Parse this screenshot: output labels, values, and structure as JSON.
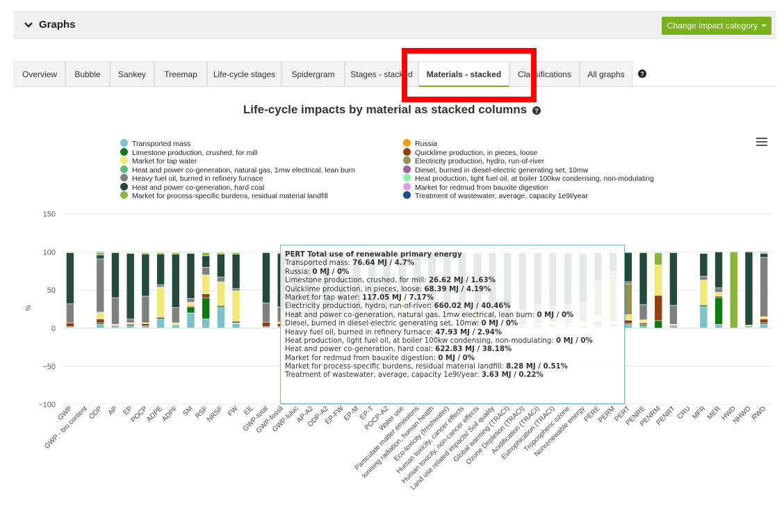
{
  "header": {
    "title": "Graphs",
    "change_button": "Change impact category"
  },
  "tabs": [
    {
      "label": "Overview"
    },
    {
      "label": "Bubble"
    },
    {
      "label": "Sankey"
    },
    {
      "label": "Treemap"
    },
    {
      "label": "Life-cycle stages"
    },
    {
      "label": "Spidergram"
    },
    {
      "label": "Stages - stacked"
    },
    {
      "label": "Materials - stacked",
      "active": true
    },
    {
      "label": "Classifications"
    },
    {
      "label": "All graphs"
    }
  ],
  "chart": {
    "title": "Life-cycle impacts by material as stacked columns"
  },
  "legend": [
    {
      "label": "Transported mass",
      "color": "#7cc2cc"
    },
    {
      "label": "Limestone production, crushed, for mill",
      "color": "#0d7a12"
    },
    {
      "label": "Market for tap water",
      "color": "#f2e777"
    },
    {
      "label": "Heat and power co-generation, natural gas, 1mw electrical, lean burn",
      "color": "#5cbd7a"
    },
    {
      "label": "Heavy fuel oil, burned in refinery furnace",
      "color": "#808080"
    },
    {
      "label": "Heat and power co-generation, hard coal",
      "color": "#25493a"
    },
    {
      "label": "Market for process-specific burdens, residual material landfill",
      "color": "#8db340"
    },
    {
      "label": "Russia",
      "color": "#f19e0e"
    },
    {
      "label": "Quicklime production, in pieces, loose",
      "color": "#923f0d"
    },
    {
      "label": "Electricity production, hydro, run-of-river",
      "color": "#9a9150"
    },
    {
      "label": "Diesel, burned in diesel-electric generating set, 10mw",
      "color": "#a35e9a"
    },
    {
      "label": "Heat production, light fuel oil, at boiler 100kw condensing, non-modulating",
      "color": "#90eeb1"
    },
    {
      "label": "Market for redmud from bauxite digestion",
      "color": "#dda0dd"
    },
    {
      "label": "Treatment of wastewater, average, capacity 1e9l/year",
      "color": "#1f4e8a"
    }
  ],
  "tooltip": {
    "title": "PERT Total use of renewable primary energy",
    "rows": [
      {
        "label": "Transported mass:",
        "value": "76.64 MJ / 4.7%"
      },
      {
        "label": "Russia:",
        "value": "0 MJ / 0%"
      },
      {
        "label": "Limestone production, crushed, for mill:",
        "value": "26.62 MJ / 1.63%"
      },
      {
        "label": "Quicklime production, in pieces, loose:",
        "value": "68.39 MJ / 4.19%"
      },
      {
        "label": "Market for tap water:",
        "value": "117.05 MJ / 7.17%"
      },
      {
        "label": "Electricity production, hydro, run-of-river:",
        "value": "660.02 MJ / 40.46%"
      },
      {
        "label": "Heat and power co-generation, natural gas, 1mw electrical, lean burn:",
        "value": "0 MJ / 0%"
      },
      {
        "label": "Diesel, burned in diesel-electric generating set, 10mw:",
        "value": "0 MJ / 0%"
      },
      {
        "label": "Heavy fuel oil, burned in refinery furnace:",
        "value": "47.93 MJ / 2.94%"
      },
      {
        "label": "Heat production, light fuel oil, at boiler 100kw condensing, non-modulating:",
        "value": "0 MJ / 0%"
      },
      {
        "label": "Heat and power co-generation, hard coal:",
        "value": "622.83 MJ / 38.18%"
      },
      {
        "label": "Market for redmud from bauxite digestion:",
        "value": "0 MJ / 0%"
      },
      {
        "label": "Market for process-specific burdens, residual material landfill:",
        "value": "8.28 MJ / 0.51%"
      },
      {
        "label": "Treatment of wastewater, average, capacity 1e9l/year:",
        "value": "3.63 MJ / 0.22%"
      }
    ]
  },
  "chart_data": {
    "type": "bar",
    "stacked": true,
    "ylabel": "%",
    "ylim": [
      -100,
      150
    ],
    "yticks": [
      150,
      100,
      50,
      0,
      -50,
      -100
    ],
    "grid": true,
    "legend_position": "top",
    "categories": [
      "GWP",
      "GWP - bio content",
      "ODP",
      "AP",
      "EP",
      "POCP",
      "ADPE",
      "ADPF",
      "SM",
      "RSF",
      "NRSF",
      "FW",
      "EE",
      "GWP-total",
      "GWP-fossil",
      "GWP-luluc",
      "AP-A2",
      "ODP-A2",
      "EP-FW",
      "EP-M",
      "EP-T",
      "POCP-A2",
      "Water use",
      "Particulate matter emissions",
      "Ionising radiation, human health",
      "Eco-toxicity (freshwater)",
      "Human toxicity, cancer effects",
      "Human toxicity, non-cancer effects",
      "Land use related impacts/ Soil quality",
      "Global warming (TRACI)",
      "Ozone Depletion (TRACI)",
      "Acidification (TRACI)",
      "Eutrophication (TRACI)",
      "Tropospheric ozone",
      "Nonrenewable energy",
      "PERE",
      "PERM",
      "PERT",
      "PENRE",
      "PENRM",
      "PENRT",
      "CRU",
      "MFR",
      "MER",
      "HWD",
      "NHWD",
      "RWD"
    ],
    "series": [
      {
        "name": "Transported mass",
        "values": [
          1,
          0,
          5,
          2,
          3,
          2,
          12,
          3,
          20,
          12,
          27,
          6,
          0,
          1,
          1,
          1,
          2,
          1,
          2,
          1,
          1,
          2,
          3,
          4,
          2,
          4,
          3,
          5,
          2,
          1,
          1,
          1,
          2,
          1,
          2,
          4,
          2,
          4.7,
          3,
          0,
          2,
          0,
          28,
          5,
          0,
          1,
          5
        ]
      },
      {
        "name": "Russia",
        "values": [
          0,
          0,
          0,
          0,
          0,
          0,
          0,
          0,
          0,
          0,
          0,
          0,
          0,
          0,
          0,
          0,
          0,
          0,
          0,
          0,
          0,
          0,
          0,
          0,
          0,
          0,
          0,
          0,
          0,
          0,
          0,
          0,
          0,
          0,
          0,
          0,
          0,
          0,
          0,
          0,
          0,
          0,
          0,
          0,
          0,
          0,
          0
        ]
      },
      {
        "name": "Limestone production, crushed, for mill",
        "values": [
          1,
          0,
          2,
          1,
          2,
          1,
          2,
          1,
          8,
          28,
          2,
          1,
          0,
          1,
          1,
          1,
          2,
          1,
          1,
          1,
          1,
          1,
          2,
          3,
          1,
          2,
          2,
          3,
          1,
          1,
          1,
          1,
          1,
          1,
          1,
          2,
          1,
          1.63,
          2,
          10,
          1,
          0,
          2,
          35,
          0,
          1,
          2
        ]
      },
      {
        "name": "Quicklime production, in pieces, loose",
        "values": [
          5,
          0,
          5,
          1,
          1,
          3,
          1,
          1,
          1,
          5,
          1,
          2,
          0,
          6,
          4,
          1,
          2,
          1,
          1,
          1,
          2,
          2,
          2,
          2,
          1,
          2,
          2,
          2,
          1,
          3,
          1,
          2,
          2,
          2,
          1,
          3,
          2,
          4.19,
          2,
          33,
          1,
          0,
          1,
          2,
          0,
          1,
          5
        ]
      },
      {
        "name": "Market for tap water",
        "values": [
          0,
          0,
          8,
          1,
          1,
          1,
          38,
          2,
          5,
          25,
          30,
          40,
          0,
          0,
          2,
          1,
          4,
          1,
          2,
          1,
          2,
          3,
          40,
          8,
          3,
          10,
          6,
          8,
          3,
          1,
          1,
          2,
          3,
          2,
          5,
          8,
          4,
          7.17,
          4,
          40,
          1,
          0,
          32,
          5,
          0,
          1,
          3
        ]
      },
      {
        "name": "Electricity production, hydro, run-of-river",
        "values": [
          0,
          0,
          0,
          0,
          0,
          0,
          0,
          0,
          0,
          0,
          0,
          0,
          0,
          0,
          0,
          0,
          0,
          0,
          0,
          0,
          0,
          0,
          0,
          0,
          0,
          0,
          0,
          0,
          0,
          0,
          0,
          0,
          0,
          0,
          0,
          40,
          60,
          40.46,
          0,
          0,
          0,
          0,
          0,
          0,
          0,
          0,
          0
        ]
      },
      {
        "name": "Heat and power co-generation, natural gas, 1mw electrical, lean burn",
        "values": [
          0,
          0,
          1,
          0,
          0,
          0,
          1,
          0,
          0,
          0,
          1,
          0,
          0,
          0,
          0,
          0,
          0,
          0,
          0,
          0,
          0,
          0,
          0,
          0,
          0,
          0,
          0,
          0,
          0,
          0,
          0,
          0,
          0,
          0,
          0,
          0,
          0,
          0,
          0,
          0,
          0,
          0,
          0,
          0,
          0,
          0,
          0
        ]
      },
      {
        "name": "Diesel, burned in diesel-electric generating set, 10mw",
        "values": [
          0,
          0,
          0,
          0,
          0,
          0,
          0,
          0,
          0,
          0,
          0,
          0,
          0,
          0,
          0,
          0,
          0,
          0,
          0,
          0,
          0,
          0,
          0,
          0,
          0,
          0,
          0,
          0,
          0,
          0,
          0,
          0,
          0,
          0,
          0,
          0,
          0,
          0,
          0,
          0,
          0,
          0,
          0,
          0,
          0,
          0,
          0
        ]
      },
      {
        "name": "Heavy fuel oil, burned in refinery furnace",
        "values": [
          25,
          0,
          70,
          35,
          5,
          35,
          3,
          20,
          5,
          10,
          6,
          3,
          0,
          25,
          20,
          10,
          20,
          10,
          15,
          15,
          20,
          20,
          10,
          15,
          20,
          15,
          20,
          15,
          20,
          20,
          20,
          25,
          20,
          25,
          25,
          5,
          5,
          2.94,
          20,
          0,
          25,
          0,
          5,
          6,
          0,
          0,
          78
        ]
      },
      {
        "name": "Heat production, light fuel oil, at boiler 100kw condensing, non-modulating",
        "values": [
          0,
          0,
          0,
          0,
          0,
          0,
          0,
          0,
          0,
          0,
          0,
          0,
          0,
          0,
          0,
          0,
          0,
          0,
          0,
          0,
          0,
          0,
          0,
          0,
          0,
          0,
          0,
          0,
          0,
          0,
          0,
          0,
          0,
          0,
          0,
          0,
          0,
          0,
          0,
          0,
          0,
          0,
          0,
          0,
          0,
          0,
          0
        ]
      },
      {
        "name": "Heat and power co-generation, hard coal",
        "values": [
          67,
          0,
          5,
          59,
          86,
          55,
          40,
          70,
          59,
          15,
          30,
          45,
          0,
          66,
          70,
          85,
          68,
          85,
          78,
          80,
          73,
          70,
          42,
          67,
          72,
          66,
          66,
          66,
          72,
          73,
          75,
          68,
          71,
          68,
          63,
          37,
          25,
          38.18,
          68,
          0,
          69,
          0,
          30,
          47,
          0,
          96,
          5
        ]
      },
      {
        "name": "Market for redmud from bauxite digestion",
        "values": [
          0,
          0,
          0,
          0,
          0,
          0,
          0,
          0,
          0,
          0,
          0,
          0,
          0,
          0,
          0,
          0,
          0,
          0,
          0,
          0,
          0,
          0,
          0,
          0,
          0,
          0,
          0,
          0,
          0,
          0,
          0,
          0,
          0,
          0,
          0,
          0,
          0,
          0,
          0,
          0,
          0,
          0,
          0,
          0,
          0,
          0,
          0
        ]
      },
      {
        "name": "Market for process-specific burdens, residual material landfill",
        "values": [
          1,
          0,
          3,
          1,
          1,
          2,
          2,
          2,
          1,
          4,
          2,
          2,
          0,
          1,
          1,
          1,
          1,
          1,
          1,
          1,
          1,
          1,
          1,
          1,
          1,
          1,
          1,
          1,
          0,
          1,
          1,
          1,
          1,
          1,
          2,
          1,
          1,
          0.51,
          1,
          16,
          1,
          0,
          1,
          0,
          100,
          1,
          1
        ]
      },
      {
        "name": "Treatment of wastewater, average, capacity 1e9l/year",
        "values": [
          0,
          0,
          1,
          0,
          0,
          0,
          0,
          0,
          0,
          0,
          0,
          0,
          0,
          0,
          0,
          0,
          0,
          0,
          0,
          0,
          0,
          0,
          0,
          0,
          0,
          0,
          0,
          0,
          0,
          0,
          0,
          0,
          0,
          0,
          0,
          0,
          0,
          0.22,
          0,
          0,
          0,
          0,
          0,
          0,
          0,
          0,
          1
        ]
      }
    ]
  }
}
